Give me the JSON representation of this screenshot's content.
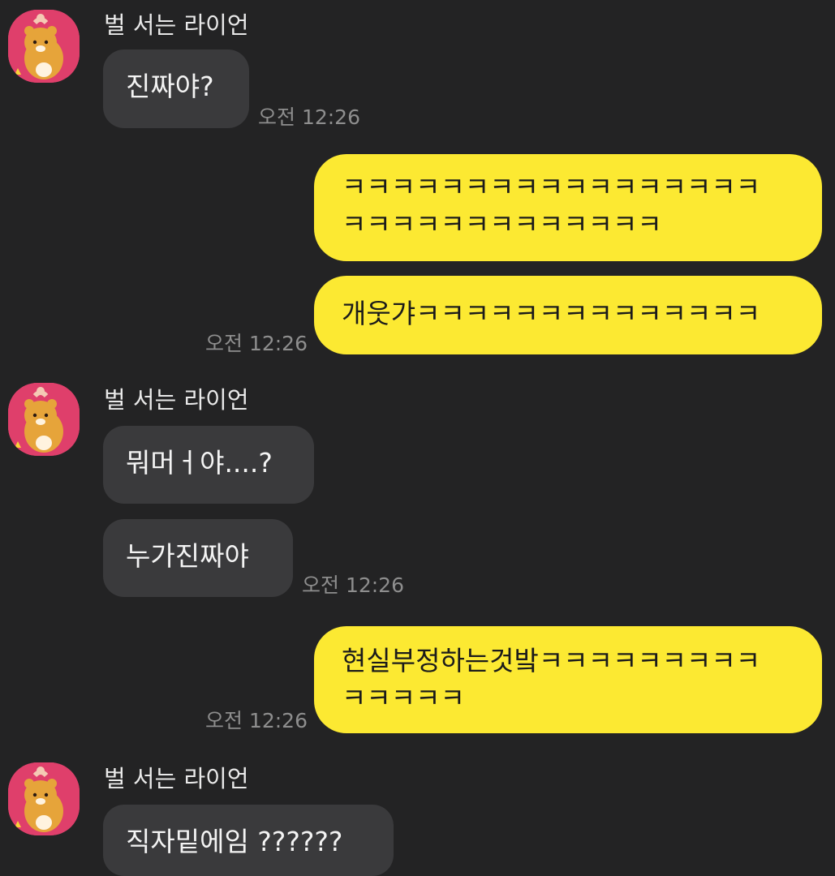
{
  "colors": {
    "background": "#232324",
    "incoming_bubble": "#3a3a3c",
    "outgoing_bubble": "#fce932",
    "avatar_background": "#df3f6b",
    "timestamp": "#8e8e8e"
  },
  "groups": [
    {
      "sender": "벌 서는 라이언",
      "avatar_icon": "ryan-character-icon",
      "messages": [
        {
          "text": "진짜야?",
          "time": "오전 12:26"
        }
      ]
    },
    {
      "outgoing": true,
      "messages": [
        {
          "lines": [
            "ㅋㅋㅋㅋㅋㅋㅋㅋㅋㅋㅋㅋㅋㅋㅋㅋㅋ",
            "ㅋㅋㅋㅋㅋㅋㅋㅋㅋㅋㅋㅋㅋ"
          ]
        },
        {
          "lines": [
            "개웃갸ㅋㅋㅋㅋㅋㅋㅋㅋㅋㅋㅋㅋㅋㅋ"
          ],
          "time": "오전 12:26"
        }
      ]
    },
    {
      "sender": "벌 서는 라이언",
      "avatar_icon": "ryan-character-icon",
      "messages": [
        {
          "text": "뭐머ㅓ야....?"
        },
        {
          "text": "누가진짜야",
          "time": "오전 12:26"
        }
      ]
    },
    {
      "outgoing": true,
      "messages": [
        {
          "lines": [
            "현실부정하는것밬ㅋㅋㅋㅋㅋㅋㅋㅋㅋ",
            "ㅋㅋㅋㅋㅋ"
          ],
          "time": "오전 12:26"
        }
      ]
    },
    {
      "sender": "벌 서는 라이언",
      "avatar_icon": "ryan-character-icon",
      "messages": [
        {
          "text": "직자밑에임 ??????"
        }
      ]
    }
  ]
}
